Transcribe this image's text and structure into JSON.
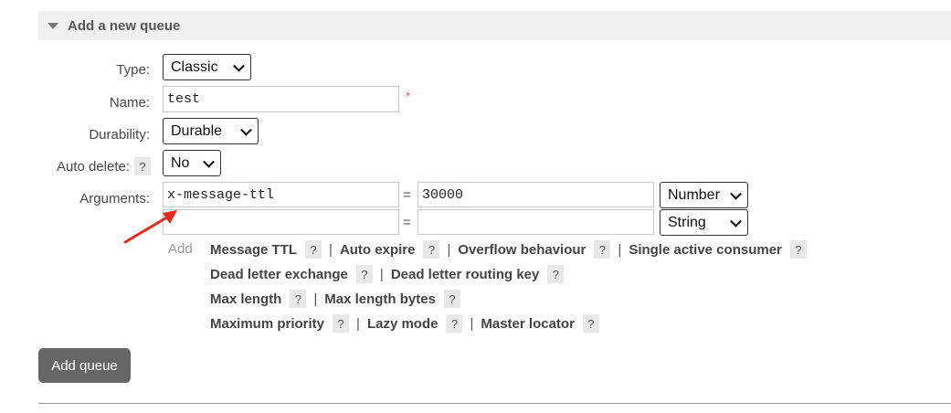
{
  "section": {
    "title": "Add a new queue"
  },
  "form": {
    "type_label": "Type:",
    "type_value": "Classic",
    "name_label": "Name:",
    "name_value": "test",
    "required_mark": "*",
    "durability_label": "Durability:",
    "durability_value": "Durable",
    "auto_delete_label": "Auto delete:",
    "auto_delete_help": "?",
    "auto_delete_value": "No",
    "arguments_label": "Arguments:",
    "arguments": [
      {
        "key": "x-message-ttl",
        "eq": "=",
        "value": "30000",
        "type": "Number"
      },
      {
        "key": "",
        "eq": "=",
        "value": "",
        "type": "String"
      }
    ],
    "add_label": "Add"
  },
  "argument_links": [
    [
      {
        "label": "Message TTL",
        "help": "?"
      },
      {
        "label": "Auto expire",
        "help": "?"
      },
      {
        "label": "Overflow behaviour",
        "help": "?"
      },
      {
        "label": "Single active consumer",
        "help": "?"
      }
    ],
    [
      {
        "label": "Dead letter exchange",
        "help": "?"
      },
      {
        "label": "Dead letter routing key",
        "help": "?"
      }
    ],
    [
      {
        "label": "Max length",
        "help": "?"
      },
      {
        "label": "Max length bytes",
        "help": "?"
      }
    ],
    [
      {
        "label": "Maximum priority",
        "help": "?"
      },
      {
        "label": "Lazy mode",
        "help": "?"
      },
      {
        "label": "Master locator",
        "help": "?"
      }
    ]
  ],
  "separator": "|",
  "buttons": {
    "add_queue": "Add queue"
  },
  "colors": {
    "annotation_arrow": "#e8291c",
    "button_bg": "#666666",
    "header_bg": "#f0f0f0"
  },
  "icons": {
    "section_toggle": "triangle-down-icon",
    "select_chevron": "chevron-down-icon",
    "annotation": "red-arrow-icon"
  }
}
